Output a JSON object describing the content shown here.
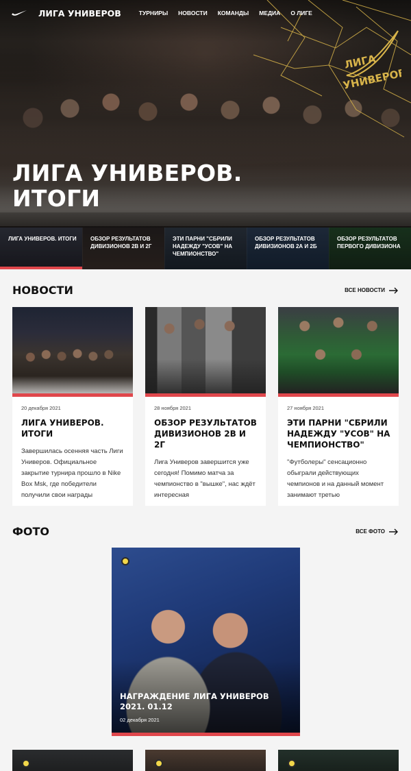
{
  "nav": {
    "brand": "ЛИГА УНИВЕРОВ",
    "links": [
      "ТУРНИРЫ",
      "НОВОСТИ",
      "КОМАНДЫ",
      "МЕДИА",
      "О ЛИГЕ"
    ]
  },
  "hero": {
    "title_line1": "ЛИГА УНИВЕРОВ.",
    "title_line2": "ИТОГИ",
    "logo_text": "ЛИГА УНИВЕРОВ",
    "tabs": [
      "ЛИГА УНИВЕРОВ. ИТОГИ",
      "ОБЗОР РЕЗУЛЬТАТОВ ДИВИЗИОНОВ 2В И 2Г",
      "ЭТИ ПАРНИ \"СБРИЛИ НАДЕЖДУ \"УСОВ\" НА ЧЕМПИОНСТВО\"",
      "ОБЗОР РЕЗУЛЬТАТОВ ДИВИЗИОНОВ 2А И 2Б",
      "ОБЗОР РЕЗУЛЬТАТОВ ПЕРВОГО ДИВИЗИОНА"
    ],
    "active_tab": 0
  },
  "news": {
    "title": "НОВОСТИ",
    "all_link": "ВСЕ НОВОСТИ",
    "items": [
      {
        "date": "20 декабря 2021",
        "title": "ЛИГА УНИВЕРОВ. ИТОГИ",
        "excerpt": "Завершилась осенняя часть Лиги Универов. Официальное закрытие турнира прошло в Nike Box Msk, где победители получили свои награды"
      },
      {
        "date": "28 ноября 2021",
        "title": "ОБЗОР РЕЗУЛЬТАТОВ ДИВИЗИОНОВ 2В И 2Г",
        "excerpt": "Лига Универов завершится уже сегодня! Помимо матча за чемпионство в \"вышке\", нас ждёт интересная"
      },
      {
        "date": "27 ноября 2021",
        "title": "ЭТИ ПАРНИ \"СБРИЛИ НАДЕЖДУ \"УСОВ\" НА ЧЕМПИОНСТВО\"",
        "excerpt": "\"Футболеры\" сенсационно обыграли действующих чемпионов и на данный момент занимают третью"
      }
    ]
  },
  "photos": {
    "title": "ФОТО",
    "all_link": "ВСЕ ФОТО",
    "featured": {
      "title": "НАГРАЖДЕНИЕ ЛИГА УНИВЕРОВ 2021. 01.12",
      "date": "02 декабря 2021"
    }
  },
  "colors": {
    "accent": "#e0474c",
    "gold": "#d8b44a",
    "camera_dot": "#f2d74a"
  }
}
